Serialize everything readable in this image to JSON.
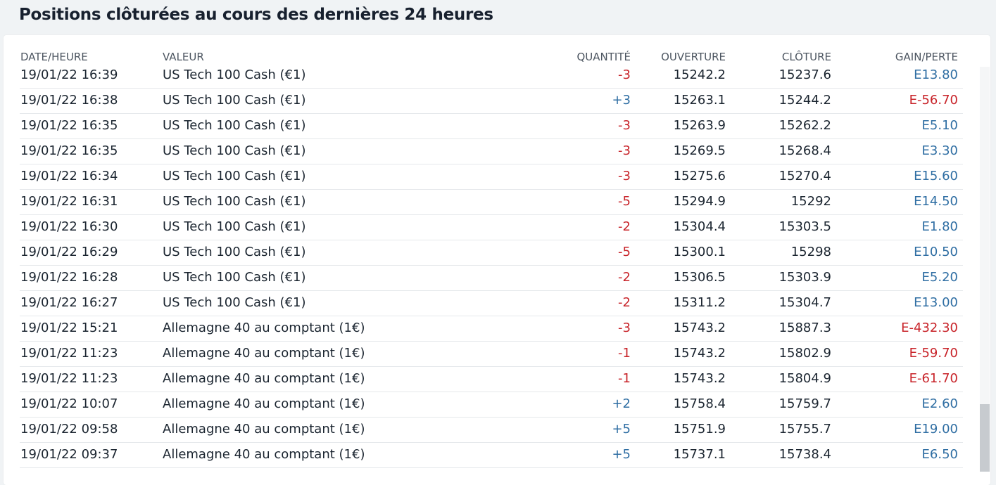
{
  "title": "Positions clôturées au cours des dernières 24 heures",
  "columns": {
    "date": "DATE/HEURE",
    "value": "VALEUR",
    "qty": "QUANTITÉ",
    "open": "OUVERTURE",
    "close": "CLÔTURE",
    "pl": "GAIN/PERTE"
  },
  "colors": {
    "negative": "#c8242a",
    "positive": "#2f6ea3"
  },
  "rows": [
    {
      "date": "19/01/22 16:39",
      "value": "US Tech 100 Cash (€1)",
      "qty": "-3",
      "open": "15242.2",
      "close": "15237.6",
      "pl": "E13.80"
    },
    {
      "date": "19/01/22 16:38",
      "value": "US Tech 100 Cash (€1)",
      "qty": "+3",
      "open": "15263.1",
      "close": "15244.2",
      "pl": "E-56.70"
    },
    {
      "date": "19/01/22 16:35",
      "value": "US Tech 100 Cash (€1)",
      "qty": "-3",
      "open": "15263.9",
      "close": "15262.2",
      "pl": "E5.10"
    },
    {
      "date": "19/01/22 16:35",
      "value": "US Tech 100 Cash (€1)",
      "qty": "-3",
      "open": "15269.5",
      "close": "15268.4",
      "pl": "E3.30"
    },
    {
      "date": "19/01/22 16:34",
      "value": "US Tech 100 Cash (€1)",
      "qty": "-3",
      "open": "15275.6",
      "close": "15270.4",
      "pl": "E15.60"
    },
    {
      "date": "19/01/22 16:31",
      "value": "US Tech 100 Cash (€1)",
      "qty": "-5",
      "open": "15294.9",
      "close": "15292",
      "pl": "E14.50"
    },
    {
      "date": "19/01/22 16:30",
      "value": "US Tech 100 Cash (€1)",
      "qty": "-2",
      "open": "15304.4",
      "close": "15303.5",
      "pl": "E1.80"
    },
    {
      "date": "19/01/22 16:29",
      "value": "US Tech 100 Cash (€1)",
      "qty": "-5",
      "open": "15300.1",
      "close": "15298",
      "pl": "E10.50"
    },
    {
      "date": "19/01/22 16:28",
      "value": "US Tech 100 Cash (€1)",
      "qty": "-2",
      "open": "15306.5",
      "close": "15303.9",
      "pl": "E5.20"
    },
    {
      "date": "19/01/22 16:27",
      "value": "US Tech 100 Cash (€1)",
      "qty": "-2",
      "open": "15311.2",
      "close": "15304.7",
      "pl": "E13.00"
    },
    {
      "date": "19/01/22 15:21",
      "value": "Allemagne 40 au comptant (1€)",
      "qty": "-3",
      "open": "15743.2",
      "close": "15887.3",
      "pl": "E-432.30"
    },
    {
      "date": "19/01/22 11:23",
      "value": "Allemagne 40 au comptant (1€)",
      "qty": "-1",
      "open": "15743.2",
      "close": "15802.9",
      "pl": "E-59.70"
    },
    {
      "date": "19/01/22 11:23",
      "value": "Allemagne 40 au comptant (1€)",
      "qty": "-1",
      "open": "15743.2",
      "close": "15804.9",
      "pl": "E-61.70"
    },
    {
      "date": "19/01/22 10:07",
      "value": "Allemagne 40 au comptant (1€)",
      "qty": "+2",
      "open": "15758.4",
      "close": "15759.7",
      "pl": "E2.60"
    },
    {
      "date": "19/01/22 09:58",
      "value": "Allemagne 40 au comptant (1€)",
      "qty": "+5",
      "open": "15751.9",
      "close": "15755.7",
      "pl": "E19.00"
    },
    {
      "date": "19/01/22 09:37",
      "value": "Allemagne 40 au comptant (1€)",
      "qty": "+5",
      "open": "15737.1",
      "close": "15738.4",
      "pl": "E6.50"
    }
  ]
}
